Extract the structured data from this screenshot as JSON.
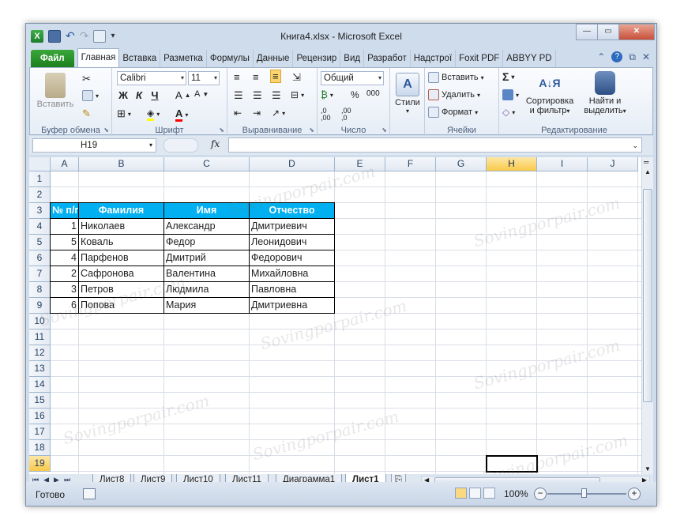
{
  "window": {
    "title": "Книга4.xlsx  -  Microsoft Excel"
  },
  "quick_access": [
    "excel-logo-icon",
    "save-icon",
    "undo-icon",
    "redo-icon",
    "customize-icon"
  ],
  "ribbon_tabs": [
    {
      "label": "Файл",
      "type": "file"
    },
    {
      "label": "Главная",
      "type": "active"
    },
    {
      "label": "Вставка"
    },
    {
      "label": "Разметка"
    },
    {
      "label": "Формулы"
    },
    {
      "label": "Данные"
    },
    {
      "label": "Рецензир"
    },
    {
      "label": "Вид"
    },
    {
      "label": "Разработ"
    },
    {
      "label": "Надстрої"
    },
    {
      "label": "Foxit PDF"
    },
    {
      "label": "ABBYY PD"
    }
  ],
  "ribbon": {
    "clipboard": {
      "label": "Буфер обмена",
      "paste": "Вставить"
    },
    "font": {
      "label": "Шрифт",
      "font_name": "Calibri",
      "font_size": "11",
      "bold": "Ж",
      "italic": "К",
      "underline": "Ч",
      "font_color_letter": "А"
    },
    "alignment": {
      "label": "Выравнивание"
    },
    "number": {
      "label": "Число",
      "format": "Общий",
      "percent": "%",
      "thousands": "000",
      "dec_inc": ",0→,00",
      "dec_dec": ",00→,0"
    },
    "styles": {
      "label": "Стили"
    },
    "cells": {
      "label": "Ячейки",
      "insert": "Вставить",
      "delete": "Удалить",
      "format": "Формат"
    },
    "editing": {
      "label": "Редактирование",
      "sigma": "Σ",
      "sort_1": "Сортировка",
      "sort_2": "и фильтр",
      "find_1": "Найти и",
      "find_2": "выделить"
    }
  },
  "formula_bar": {
    "name_box": "H19",
    "fx": "fx",
    "formula": ""
  },
  "columns": [
    "A",
    "B",
    "C",
    "D",
    "E",
    "F",
    "G",
    "H",
    "I",
    "J"
  ],
  "selected_column": "H",
  "rows": [
    "1",
    "2",
    "3",
    "4",
    "5",
    "6",
    "7",
    "8",
    "9",
    "10",
    "11",
    "12",
    "13",
    "14",
    "15",
    "16",
    "17",
    "18",
    "19"
  ],
  "selected_row": "19",
  "table": {
    "headers": [
      "№ п/п",
      "Фамилия",
      "Имя",
      "Отчество"
    ],
    "rows": [
      [
        "1",
        "Николаев",
        "Александр",
        "Дмитриевич"
      ],
      [
        "5",
        "Коваль",
        "Федор",
        "Леонидович"
      ],
      [
        "4",
        "Парфенов",
        "Дмитрий",
        "Федорович"
      ],
      [
        "2",
        "Сафронова",
        "Валентина",
        "Михайловна"
      ],
      [
        "3",
        "Петров",
        "Людмила",
        "Павловна"
      ],
      [
        "6",
        "Попова",
        "Мария",
        "Дмитриевна"
      ]
    ],
    "header_color": "#00b0f0"
  },
  "sheet_tabs": [
    {
      "label": "Лист8"
    },
    {
      "label": "Лист9"
    },
    {
      "label": "Лист10"
    },
    {
      "label": "Лист11"
    },
    {
      "label": "Диаграмма1"
    },
    {
      "label": "Лист1",
      "active": true
    }
  ],
  "status": {
    "ready": "Готово",
    "zoom": "100%"
  },
  "watermark": "Sovingporpair.com"
}
